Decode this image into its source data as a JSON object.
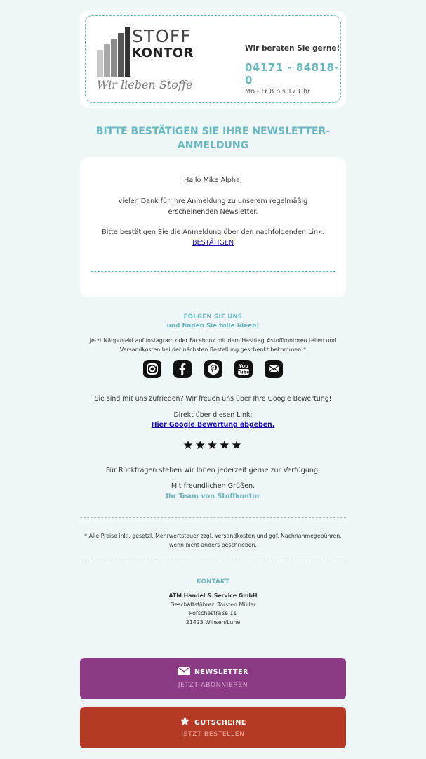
{
  "header": {
    "logo": {
      "line1": "STOFF",
      "line2": "KONTOR",
      "slogan": "Wir lieben Stoffe"
    },
    "advice": "Wir beraten Sie gerne!",
    "phone": "04171 - 84818-0",
    "hours": "Mo - Fr 8 bis 17 Uhr"
  },
  "title": "BITTE BESTÄTIGEN SIE IHRE NEWSLETTER-ANMELDUNG",
  "message": {
    "greeting": "Hallo Mike Alpha,",
    "thanks": "vielen Dank für Ihre Anmeldung zu unserem regelmäßig erscheinenden Newsletter.",
    "confirm_text": "Bitte bestätigen Sie die Anmeldung über den nachfolgenden Link:",
    "confirm_link": "BESTÄTIGEN"
  },
  "follow": {
    "heading": "FOLGEN SIE UNS",
    "subheading": "und finden Sie tolle Ideen!",
    "text": "Jetzt Nähprojekt auf Instagram oder Facebook mit dem Hashtag #stoffkontoreu teilen und Versandkosten bei der nächsten Bestellung geschenkt bekommen!*",
    "icons": [
      "instagram-icon",
      "facebook-icon",
      "pinterest-icon",
      "youtube-icon",
      "email-icon"
    ]
  },
  "review": {
    "satisfied": "Sie sind mit uns zufrieden? Wir freuen uns über Ihre Google Bewertung!",
    "direct": "Direkt über diesen Link:",
    "link": "Hier Google Bewertung abgeben.",
    "stars": "★★★★★"
  },
  "closing": {
    "questions": "Für Rückfragen stehen wir Ihnen jederzeit gerne zur Verfügung.",
    "regards": "Mit freundlichen Grüßen,",
    "team": "Ihr Team von Stoffkontor"
  },
  "disclaimer": "* Alle Preise inkl. gesetzl. Mehrwertsteuer zzgl. Versandkosten und ggf. Nachnahmegebühren, wenn nicht anders beschrieben.",
  "kontakt": {
    "heading": "KONTAKT",
    "company": "ATM Handel & Service GmbH",
    "ceo": "Geschäftsführer: Torsten Müller",
    "street": "Porschestraße 11",
    "city": "21423 Winsen/Luhe"
  },
  "buttons": {
    "newsletter": {
      "top": "NEWSLETTER",
      "bottom": "JETZT ABONNIEREN",
      "color": "#8d3a86"
    },
    "vouchers": {
      "top": "GUTSCHEINE",
      "bottom": "JETZT BESTELLEN",
      "color": "#b53a26"
    }
  },
  "colors": {
    "accent": "#6ab7c1",
    "background": "#eef6f7"
  }
}
